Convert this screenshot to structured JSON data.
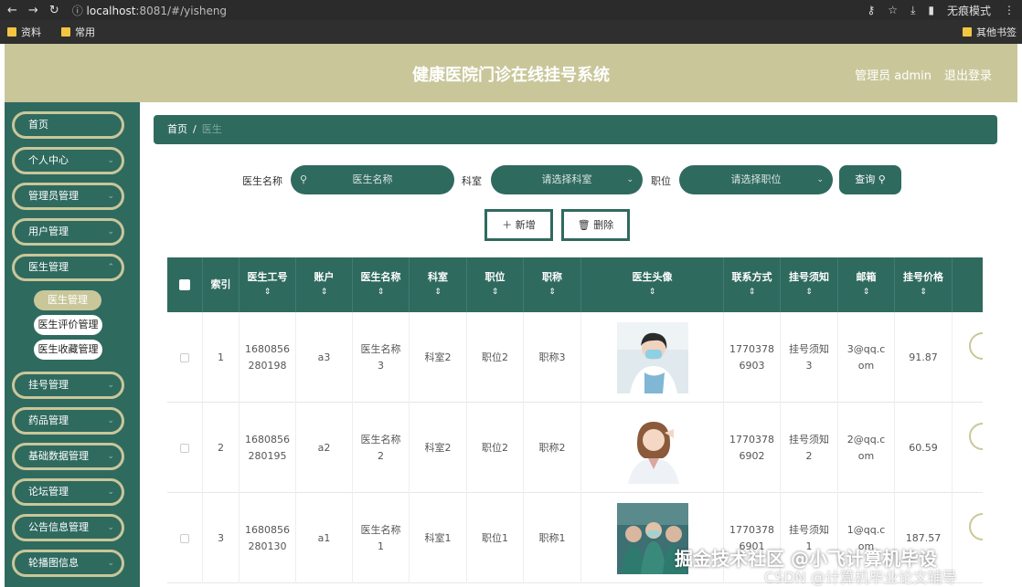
{
  "browser": {
    "url_host": "localhost",
    "url_rest": ":8081/#/yisheng",
    "incognito_label": "无痕模式",
    "bookmarks": [
      "资料",
      "常用"
    ],
    "other_bookmarks": "其他书签"
  },
  "header": {
    "title": "健康医院门诊在线挂号系统",
    "admin": "管理员 admin",
    "logout": "退出登录"
  },
  "sidebar": {
    "items": [
      {
        "label": "首页",
        "has_chevron": false
      },
      {
        "label": "个人中心",
        "has_chevron": true
      },
      {
        "label": "管理员管理",
        "has_chevron": true
      },
      {
        "label": "用户管理",
        "has_chevron": true
      },
      {
        "label": "医生管理",
        "has_chevron": true
      },
      {
        "label": "挂号管理",
        "has_chevron": true
      },
      {
        "label": "药品管理",
        "has_chevron": true
      },
      {
        "label": "基础数据管理",
        "has_chevron": true
      },
      {
        "label": "论坛管理",
        "has_chevron": true
      },
      {
        "label": "公告信息管理",
        "has_chevron": true
      },
      {
        "label": "轮播图信息",
        "has_chevron": true
      }
    ],
    "sub_items": [
      "医生管理",
      "医生评价管理",
      "医生收藏管理"
    ]
  },
  "breadcrumb": {
    "home": "首页",
    "separator": "/",
    "current": "医生"
  },
  "search": {
    "doctor_name_label": "医生名称",
    "doctor_name_placeholder": "医生名称",
    "dept_label": "科室",
    "dept_placeholder": "请选择科室",
    "title_label": "职位",
    "title_placeholder": "请选择职位",
    "query_button": "查询"
  },
  "actions": {
    "add": "新增",
    "delete": "删除"
  },
  "table": {
    "columns": [
      "索引",
      "医生工号",
      "账户",
      "医生名称",
      "科室",
      "职位",
      "职称",
      "医生头像",
      "联系方式",
      "挂号须知",
      "邮箱",
      "挂号价格"
    ],
    "rows": [
      {
        "index": "1",
        "job_no": [
          "1680856",
          "280198"
        ],
        "account": "a3",
        "name": [
          "医生名称",
          "3"
        ],
        "dept": "科室2",
        "position": "职位2",
        "title": "职称3",
        "phone": [
          "1770378",
          "6903"
        ],
        "notice": [
          "挂号须知",
          "3"
        ],
        "email": [
          "3@qq.c",
          "om"
        ],
        "price": "91.87"
      },
      {
        "index": "2",
        "job_no": [
          "1680856",
          "280195"
        ],
        "account": "a2",
        "name": [
          "医生名称",
          "2"
        ],
        "dept": "科室2",
        "position": "职位2",
        "title": "职称2",
        "phone": [
          "1770378",
          "6902"
        ],
        "notice": [
          "挂号须知",
          "2"
        ],
        "email": [
          "2@qq.c",
          "om"
        ],
        "price": "60.59"
      },
      {
        "index": "3",
        "job_no": [
          "1680856",
          "280130"
        ],
        "account": "a1",
        "name": [
          "医生名称",
          "1"
        ],
        "dept": "科室1",
        "position": "职位1",
        "title": "职称1",
        "phone": [
          "1770378",
          "6901"
        ],
        "notice": [
          "挂号须知",
          "1"
        ],
        "email": [
          "1@qq.c",
          "om"
        ],
        "price": "187.57"
      }
    ]
  },
  "watermark": {
    "line1": "掘金技术社区 @小飞计算机毕设",
    "line2": "CSDN @计算机毕业论文辅导"
  },
  "colors": {
    "primary": "#2f6a5f",
    "accent": "#c9c79a"
  }
}
